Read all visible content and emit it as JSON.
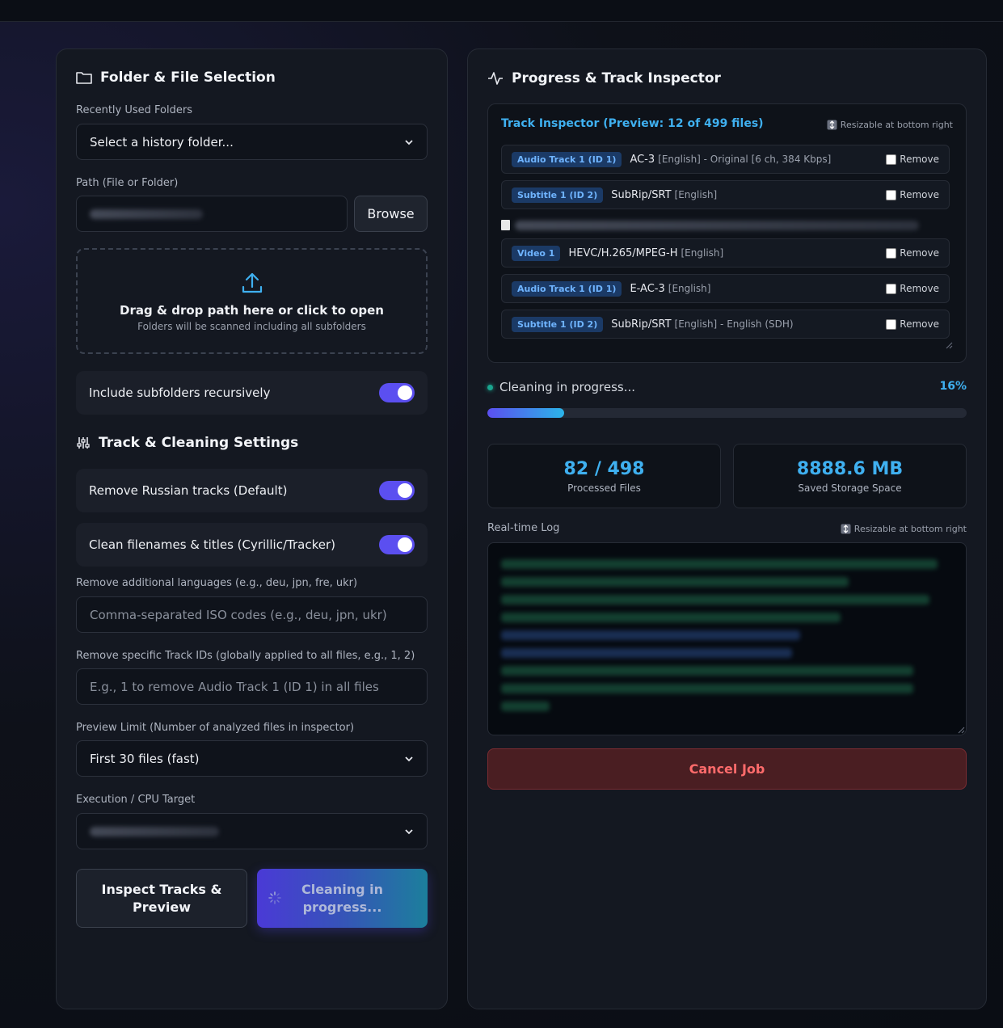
{
  "left": {
    "title": "Folder & File Selection",
    "recent_label": "Recently Used Folders",
    "recent_value": "Select a history folder...",
    "path_label": "Path (File or Folder)",
    "path_value": "",
    "browse": "Browse",
    "dropzone": {
      "main": "Drag & drop path here or click to open",
      "sub": "Folders will be scanned including all subfolders"
    },
    "recursive": {
      "label": "Include subfolders recursively",
      "on": true
    },
    "settings_title": "Track & Cleaning Settings",
    "remove_russian": {
      "label": "Remove Russian tracks (Default)",
      "on": true
    },
    "clean_names": {
      "label": "Clean filenames & titles (Cyrillic/Tracker)",
      "on": true
    },
    "langs_label": "Remove additional languages (e.g., deu, jpn, fre, ukr)",
    "langs_placeholder": "Comma-separated ISO codes (e.g., deu, jpn, ukr)",
    "ids_label": "Remove specific Track IDs (globally applied to all files, e.g., 1, 2)",
    "ids_placeholder": "E.g., 1 to remove Audio Track 1 (ID 1) in all files",
    "preview_label": "Preview Limit (Number of analyzed files in inspector)",
    "preview_value": "First 30 files (fast)",
    "cpu_label": "Execution / CPU Target",
    "inspect_btn": "Inspect Tracks & Preview",
    "cleaning_btn": "Cleaning in progress..."
  },
  "right": {
    "title": "Progress & Track Inspector",
    "inspector_title": "Track Inspector (Preview: 12 of 499 files)",
    "resize_hint": "Resizable at bottom right",
    "remove_label": "Remove",
    "tracks_a": [
      {
        "badge": "Audio Track 1 (ID 1)",
        "codec": "AC-3",
        "meta": "[English] - Original [6 ch, 384 Kbps]"
      },
      {
        "badge": "Subtitle 1 (ID 2)",
        "codec": "SubRip/SRT",
        "meta": "[English]"
      }
    ],
    "tracks_b": [
      {
        "badge": "Video 1",
        "codec": "HEVC/H.265/MPEG-H",
        "meta": "[English]"
      },
      {
        "badge": "Audio Track 1 (ID 1)",
        "codec": "E-AC-3",
        "meta": "[English]"
      },
      {
        "badge": "Subtitle 1 (ID 2)",
        "codec": "SubRip/SRT",
        "meta": "[English] - English (SDH)"
      }
    ],
    "status": "Cleaning in progress...",
    "percent_text": "16%",
    "progress": 0.16,
    "processed": "82 / 498",
    "processed_caption": "Processed Files",
    "saved": "8888.6 MB",
    "saved_caption": "Saved Storage Space",
    "log_label": "Real-time Log",
    "log_hint": "Resizable at bottom right",
    "cancel": "Cancel Job"
  },
  "colors": {
    "accent": "#5b4ff0",
    "info": "#3fb0f0",
    "danger": "#ff6b6b"
  }
}
